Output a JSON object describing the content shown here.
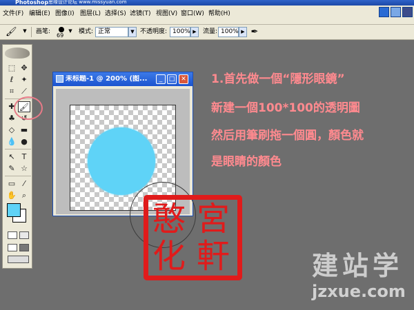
{
  "titlebar": {
    "title": "Photoshop",
    "site_watermark": "思缘设计论坛 www.missyuan.com"
  },
  "menu": [
    {
      "name": "menu-file",
      "label": "文件(F)"
    },
    {
      "name": "menu-edit",
      "label": "编辑(E)"
    },
    {
      "name": "menu-image",
      "label": "图像(I)"
    },
    {
      "name": "menu-layer",
      "label": "图层(L)"
    },
    {
      "name": "menu-select",
      "label": "选择(S)"
    },
    {
      "name": "menu-filter",
      "label": "滤镜(T)"
    },
    {
      "name": "menu-view",
      "label": "视图(V)"
    },
    {
      "name": "menu-window",
      "label": "窗口(W)"
    },
    {
      "name": "menu-help",
      "label": "帮助(H)"
    }
  ],
  "options": {
    "brush_label": "画笔:",
    "brush_size": "69",
    "mode_label": "模式:",
    "mode_value": "正常",
    "opacity_label": "不透明度:",
    "opacity_value": "100%",
    "flow_label": "流量:",
    "flow_value": "100%"
  },
  "document": {
    "title": "未标题-1 @ 200% (图...",
    "min": "_",
    "max": "□",
    "close": "✕"
  },
  "colors": {
    "foreground": "#5fd3f7",
    "background": "#ffffff",
    "instruction_text": "#ff8a8f",
    "seal": "#e01b1b"
  },
  "instructions": [
    "1.首先做一個“隱形眼鏡”",
    "新建一個100*100的透明圖",
    "然后用筆刷拖一個圓，顏色就",
    "是眼睛的顏色"
  ],
  "seal": {
    "chars": [
      "憨",
      "宮",
      "化",
      "軒"
    ]
  },
  "watermark": {
    "logo": "建站学",
    "site": "jzxue.com"
  }
}
